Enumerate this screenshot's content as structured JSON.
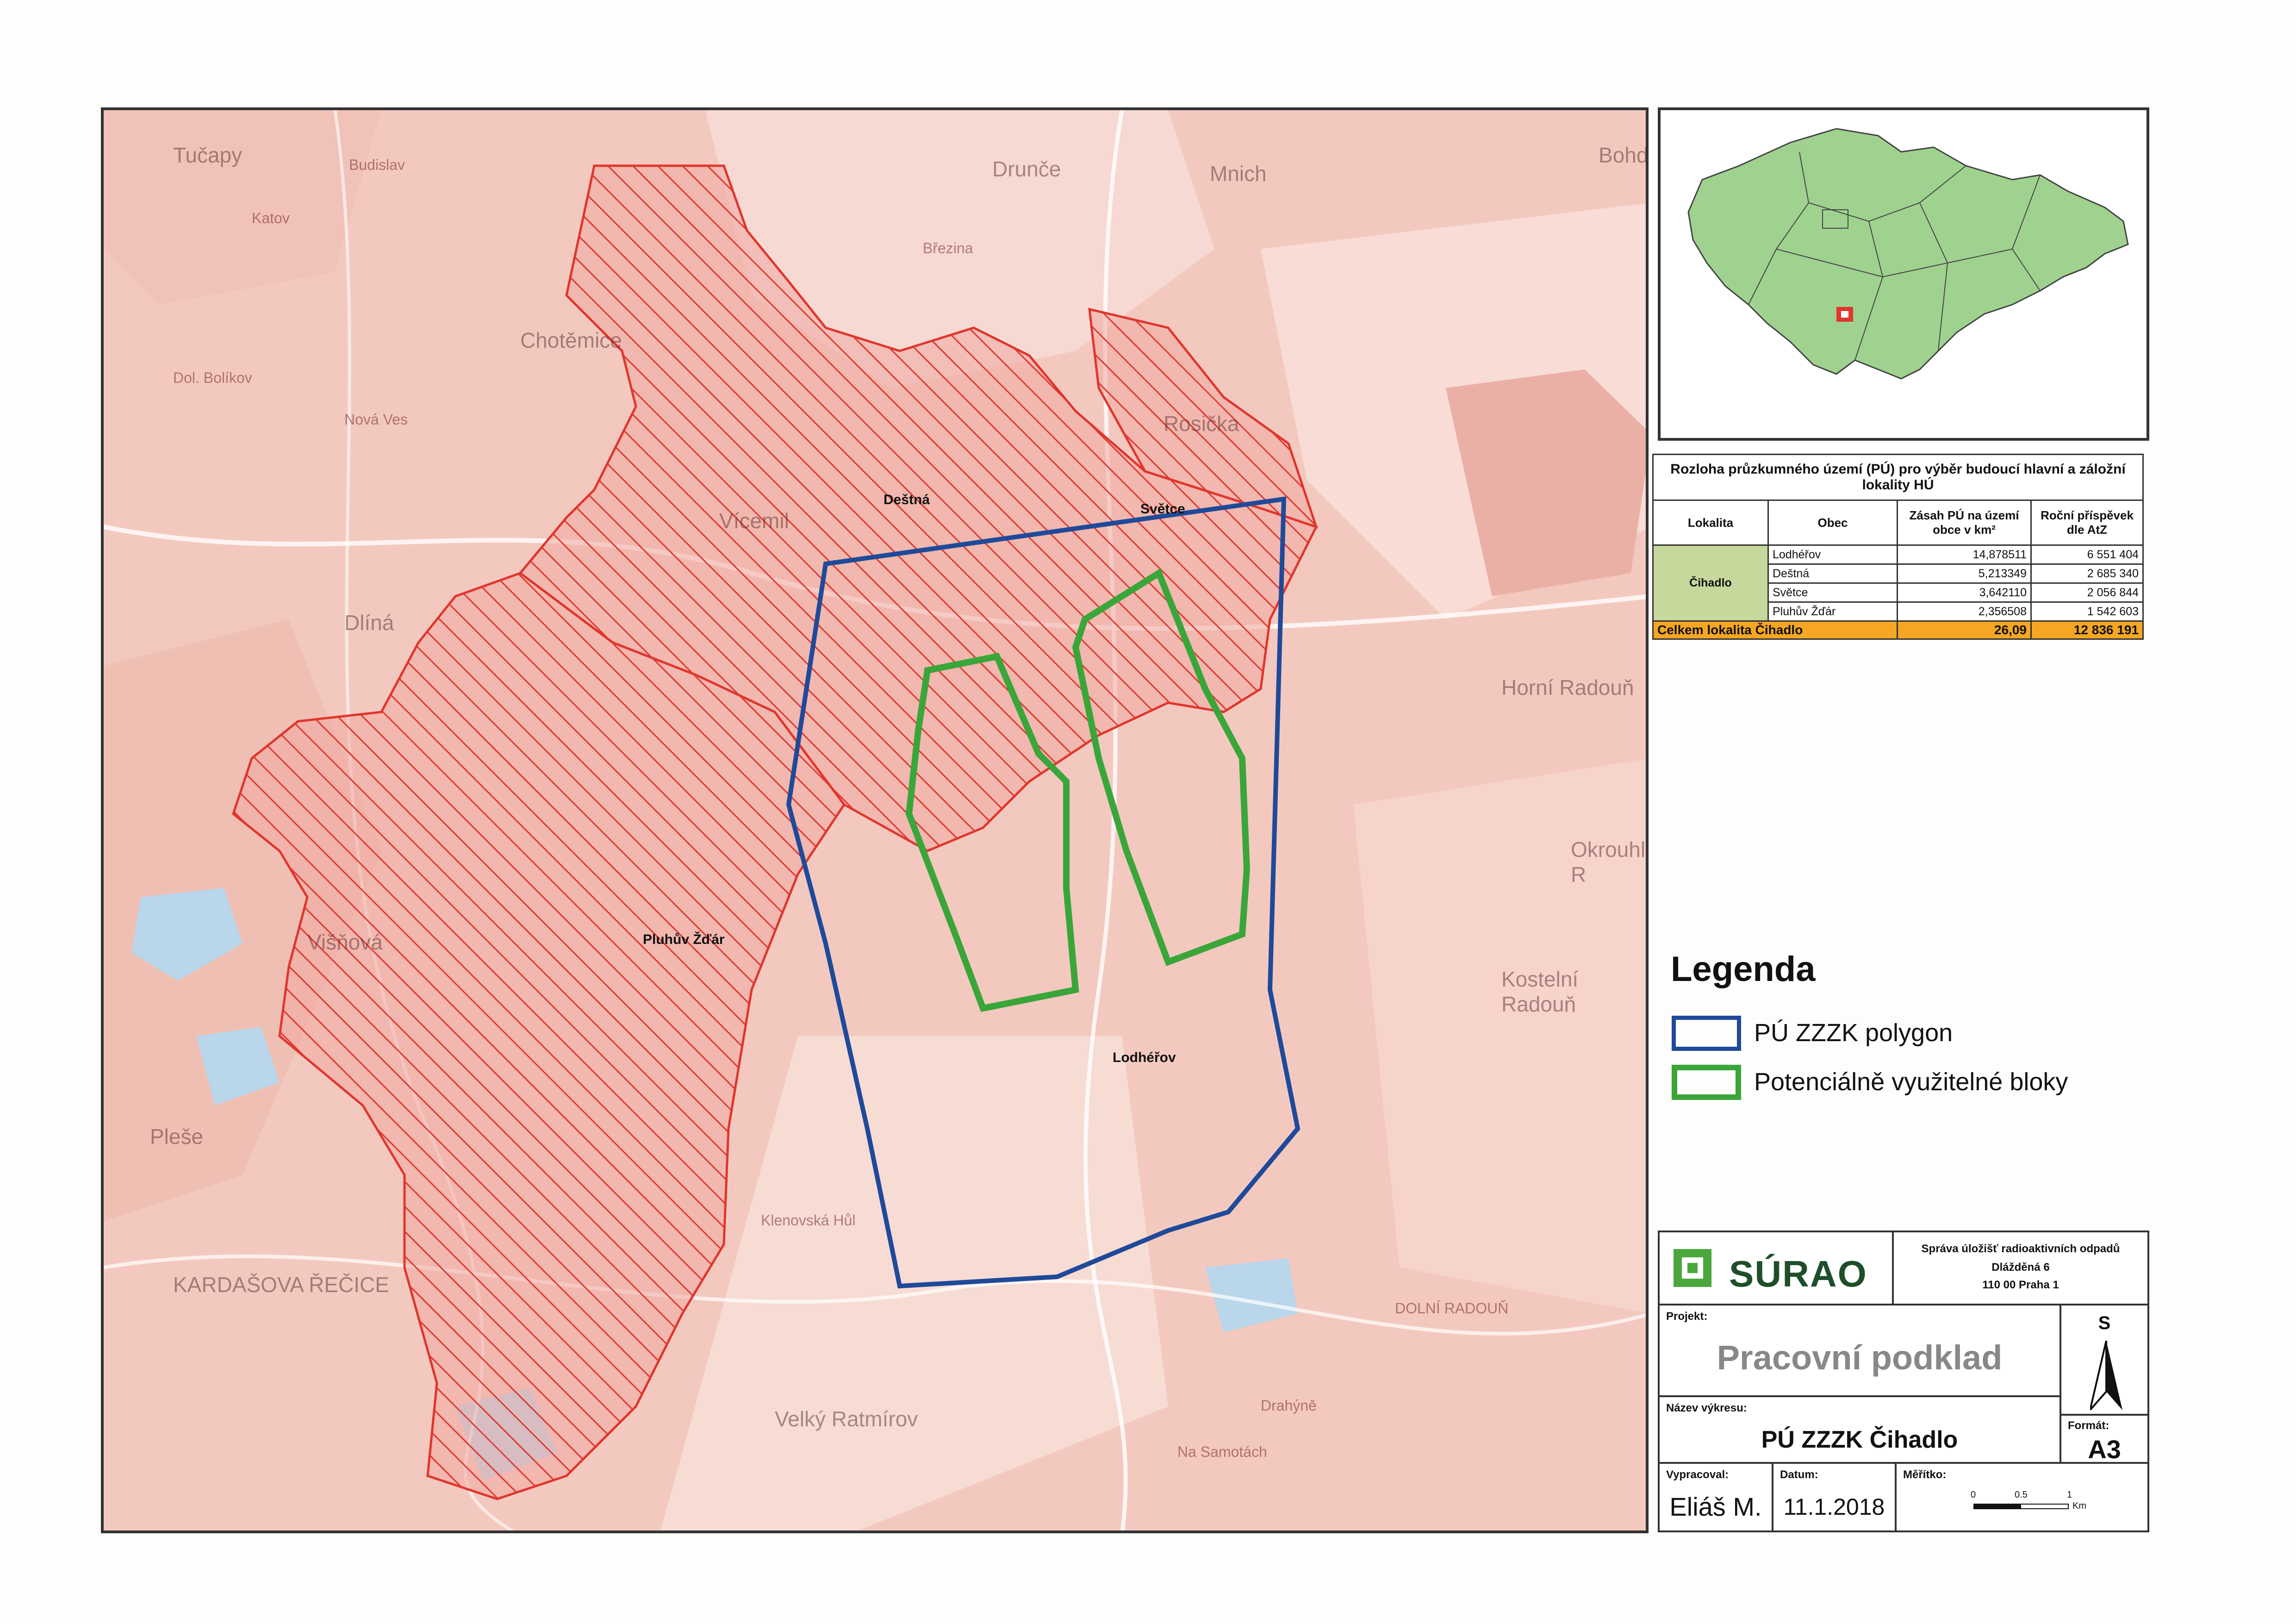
{
  "map": {
    "places": {
      "destna": "Deštná",
      "svetce": "Světce",
      "pluhuv_zdar": "Pluhův Žďár",
      "lodherov": "Lodhéřov"
    },
    "background_places": {
      "tucapy": "Tučapy",
      "budislav": "Budislav",
      "katov": "Katov",
      "drunce": "Drunče",
      "brezina": "Březina",
      "mnich": "Mnich",
      "bohdalin": "Bohdalín",
      "chotemice": "Chotěmice",
      "rosicka": "Rosička",
      "nova_ves": "Nová Ves",
      "dolni_bolikov": "Dol. Bolíkov",
      "vicemil": "Vícemil",
      "dlina": "Dlíná",
      "horni_radoun": "Horní Radouň",
      "okrouhla": "Okrouhlá R",
      "kostelni_radoun": "Kostelní Radouň",
      "kardasova_recice": "KARDAŠOVA ŘEČICE",
      "velky_ratmirov": "Velký Ratmírov",
      "pleso": "Pleše",
      "visnova": "Višňová",
      "klenovska_hut": "Klenovská Hůl",
      "dolni_radoun": "DOLNÍ RADOUŇ",
      "na_samotach": "Na Samotách",
      "drahyne": "Drahýně"
    }
  },
  "table": {
    "title": "Rozloha průzkumného území (PÚ) pro výběr budoucí hlavní a záložní lokality HÚ",
    "headers": {
      "lokalita": "Lokalita",
      "obec": "Obec",
      "zasah": "Zásah PÚ na území obce v km²",
      "prispevek": "Roční příspěvek dle AtZ"
    },
    "lokalita": "Čihadlo",
    "rows": [
      {
        "obec": "Lodhéřov",
        "zasah": "14,878511",
        "prispevek": "6 551 404"
      },
      {
        "obec": "Deštná",
        "zasah": "5,213349",
        "prispevek": "2 685 340"
      },
      {
        "obec": "Světce",
        "zasah": "3,642110",
        "prispevek": "2 056 844"
      },
      {
        "obec": "Pluhův Žďár",
        "zasah": "2,356508",
        "prispevek": "1 542 603"
      }
    ],
    "total": {
      "label": "Celkem lokalita Čihadlo",
      "zasah": "26,09",
      "prispevek": "12 836 191"
    }
  },
  "legend": {
    "title": "Legenda",
    "items": [
      {
        "label": "PÚ ZZZK polygon",
        "color": "#1f4a9a"
      },
      {
        "label": "Potenciálně využitelné bloky",
        "color": "#3aa63a"
      }
    ]
  },
  "title_block": {
    "org_name": "SÚRAO",
    "org_full": "Správa úložišť radioaktivních odpadů",
    "street": "Dlážděná 6",
    "city": "110 00   Praha 1",
    "projekt_label": "Projekt:",
    "projekt": "Pracovní podklad",
    "nazev_label": "Název výkresu:",
    "nazev": "PÚ ZZZK Čihadlo",
    "north": "S",
    "format_label": "Formát:",
    "format": "A3",
    "vypracoval_label": "Vypracoval:",
    "vypracoval": "Eliáš M.",
    "datum_label": "Datum:",
    "datum": "11.1.2018",
    "meritko_label": "Měřítko:",
    "scale_ticks": [
      "0",
      "0.5",
      "1"
    ],
    "scale_unit": "Km"
  },
  "colors": {
    "map_base": "#f3c9bf",
    "hatch_red": "#e0362e",
    "polygon_blue": "#1f4a9a",
    "blocks_green": "#3aa63a",
    "inset_green": "#9fd28e",
    "total_orange": "#f5a623",
    "lokalita_green": "#c6d89b"
  }
}
